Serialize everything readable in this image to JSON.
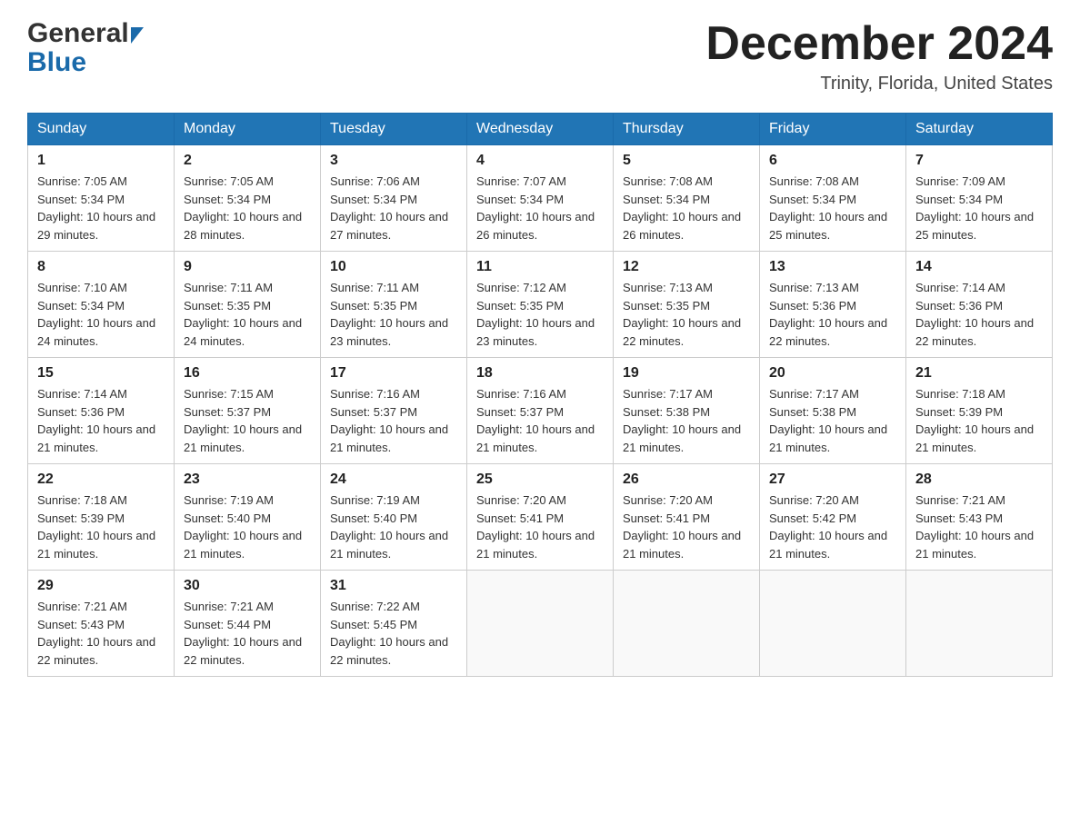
{
  "header": {
    "logo_general": "General",
    "logo_blue": "Blue",
    "month_title": "December 2024",
    "location": "Trinity, Florida, United States"
  },
  "weekdays": [
    "Sunday",
    "Monday",
    "Tuesday",
    "Wednesday",
    "Thursday",
    "Friday",
    "Saturday"
  ],
  "weeks": [
    [
      {
        "day": "1",
        "sunrise": "7:05 AM",
        "sunset": "5:34 PM",
        "daylight": "10 hours and 29 minutes."
      },
      {
        "day": "2",
        "sunrise": "7:05 AM",
        "sunset": "5:34 PM",
        "daylight": "10 hours and 28 minutes."
      },
      {
        "day": "3",
        "sunrise": "7:06 AM",
        "sunset": "5:34 PM",
        "daylight": "10 hours and 27 minutes."
      },
      {
        "day": "4",
        "sunrise": "7:07 AM",
        "sunset": "5:34 PM",
        "daylight": "10 hours and 26 minutes."
      },
      {
        "day": "5",
        "sunrise": "7:08 AM",
        "sunset": "5:34 PM",
        "daylight": "10 hours and 26 minutes."
      },
      {
        "day": "6",
        "sunrise": "7:08 AM",
        "sunset": "5:34 PM",
        "daylight": "10 hours and 25 minutes."
      },
      {
        "day": "7",
        "sunrise": "7:09 AM",
        "sunset": "5:34 PM",
        "daylight": "10 hours and 25 minutes."
      }
    ],
    [
      {
        "day": "8",
        "sunrise": "7:10 AM",
        "sunset": "5:34 PM",
        "daylight": "10 hours and 24 minutes."
      },
      {
        "day": "9",
        "sunrise": "7:11 AM",
        "sunset": "5:35 PM",
        "daylight": "10 hours and 24 minutes."
      },
      {
        "day": "10",
        "sunrise": "7:11 AM",
        "sunset": "5:35 PM",
        "daylight": "10 hours and 23 minutes."
      },
      {
        "day": "11",
        "sunrise": "7:12 AM",
        "sunset": "5:35 PM",
        "daylight": "10 hours and 23 minutes."
      },
      {
        "day": "12",
        "sunrise": "7:13 AM",
        "sunset": "5:35 PM",
        "daylight": "10 hours and 22 minutes."
      },
      {
        "day": "13",
        "sunrise": "7:13 AM",
        "sunset": "5:36 PM",
        "daylight": "10 hours and 22 minutes."
      },
      {
        "day": "14",
        "sunrise": "7:14 AM",
        "sunset": "5:36 PM",
        "daylight": "10 hours and 22 minutes."
      }
    ],
    [
      {
        "day": "15",
        "sunrise": "7:14 AM",
        "sunset": "5:36 PM",
        "daylight": "10 hours and 21 minutes."
      },
      {
        "day": "16",
        "sunrise": "7:15 AM",
        "sunset": "5:37 PM",
        "daylight": "10 hours and 21 minutes."
      },
      {
        "day": "17",
        "sunrise": "7:16 AM",
        "sunset": "5:37 PM",
        "daylight": "10 hours and 21 minutes."
      },
      {
        "day": "18",
        "sunrise": "7:16 AM",
        "sunset": "5:37 PM",
        "daylight": "10 hours and 21 minutes."
      },
      {
        "day": "19",
        "sunrise": "7:17 AM",
        "sunset": "5:38 PM",
        "daylight": "10 hours and 21 minutes."
      },
      {
        "day": "20",
        "sunrise": "7:17 AM",
        "sunset": "5:38 PM",
        "daylight": "10 hours and 21 minutes."
      },
      {
        "day": "21",
        "sunrise": "7:18 AM",
        "sunset": "5:39 PM",
        "daylight": "10 hours and 21 minutes."
      }
    ],
    [
      {
        "day": "22",
        "sunrise": "7:18 AM",
        "sunset": "5:39 PM",
        "daylight": "10 hours and 21 minutes."
      },
      {
        "day": "23",
        "sunrise": "7:19 AM",
        "sunset": "5:40 PM",
        "daylight": "10 hours and 21 minutes."
      },
      {
        "day": "24",
        "sunrise": "7:19 AM",
        "sunset": "5:40 PM",
        "daylight": "10 hours and 21 minutes."
      },
      {
        "day": "25",
        "sunrise": "7:20 AM",
        "sunset": "5:41 PM",
        "daylight": "10 hours and 21 minutes."
      },
      {
        "day": "26",
        "sunrise": "7:20 AM",
        "sunset": "5:41 PM",
        "daylight": "10 hours and 21 minutes."
      },
      {
        "day": "27",
        "sunrise": "7:20 AM",
        "sunset": "5:42 PM",
        "daylight": "10 hours and 21 minutes."
      },
      {
        "day": "28",
        "sunrise": "7:21 AM",
        "sunset": "5:43 PM",
        "daylight": "10 hours and 21 minutes."
      }
    ],
    [
      {
        "day": "29",
        "sunrise": "7:21 AM",
        "sunset": "5:43 PM",
        "daylight": "10 hours and 22 minutes."
      },
      {
        "day": "30",
        "sunrise": "7:21 AM",
        "sunset": "5:44 PM",
        "daylight": "10 hours and 22 minutes."
      },
      {
        "day": "31",
        "sunrise": "7:22 AM",
        "sunset": "5:45 PM",
        "daylight": "10 hours and 22 minutes."
      },
      null,
      null,
      null,
      null
    ]
  ]
}
